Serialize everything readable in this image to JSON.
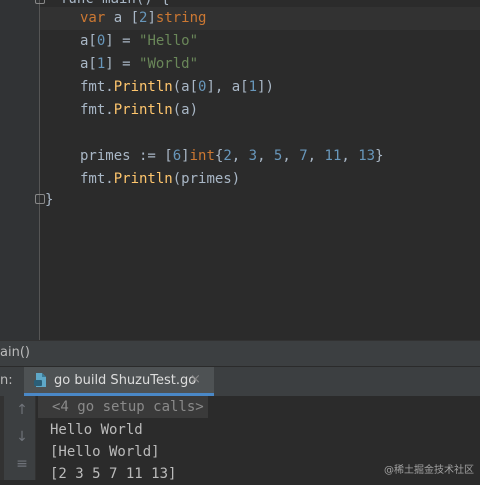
{
  "editor": {
    "top_clipped_text": "func main() {",
    "lines": [
      {
        "tokens": [
          {
            "t": "var",
            "c": "kw"
          },
          {
            "t": " a [",
            "c": ""
          },
          {
            "t": "2",
            "c": "num"
          },
          {
            "t": "]",
            "c": ""
          },
          {
            "t": "string",
            "c": "ty"
          }
        ]
      },
      {
        "tokens": [
          {
            "t": "a[",
            "c": ""
          },
          {
            "t": "0",
            "c": "num"
          },
          {
            "t": "] = ",
            "c": ""
          },
          {
            "t": "\"Hello\"",
            "c": "str"
          }
        ]
      },
      {
        "tokens": [
          {
            "t": "a[",
            "c": ""
          },
          {
            "t": "1",
            "c": "num"
          },
          {
            "t": "] = ",
            "c": ""
          },
          {
            "t": "\"World\"",
            "c": "str"
          }
        ]
      },
      {
        "tokens": [
          {
            "t": "fmt.",
            "c": ""
          },
          {
            "t": "Println",
            "c": "fn"
          },
          {
            "t": "(a[",
            "c": ""
          },
          {
            "t": "0",
            "c": "num"
          },
          {
            "t": "], a[",
            "c": ""
          },
          {
            "t": "1",
            "c": "num"
          },
          {
            "t": "])",
            "c": ""
          }
        ]
      },
      {
        "tokens": [
          {
            "t": "fmt.",
            "c": ""
          },
          {
            "t": "Println",
            "c": "fn"
          },
          {
            "t": "(a)",
            "c": ""
          }
        ]
      },
      {
        "tokens": []
      },
      {
        "tokens": [
          {
            "t": "primes := [",
            "c": ""
          },
          {
            "t": "6",
            "c": "num"
          },
          {
            "t": "]",
            "c": ""
          },
          {
            "t": "int",
            "c": "ty"
          },
          {
            "t": "{",
            "c": ""
          },
          {
            "t": "2",
            "c": "num"
          },
          {
            "t": ", ",
            "c": ""
          },
          {
            "t": "3",
            "c": "num"
          },
          {
            "t": ", ",
            "c": ""
          },
          {
            "t": "5",
            "c": "num"
          },
          {
            "t": ", ",
            "c": ""
          },
          {
            "t": "7",
            "c": "num"
          },
          {
            "t": ", ",
            "c": ""
          },
          {
            "t": "11",
            "c": "num"
          },
          {
            "t": ", ",
            "c": ""
          },
          {
            "t": "13",
            "c": "num"
          },
          {
            "t": "}",
            "c": ""
          }
        ]
      },
      {
        "tokens": [
          {
            "t": "fmt.",
            "c": ""
          },
          {
            "t": "Println",
            "c": "fn"
          },
          {
            "t": "(primes)",
            "c": ""
          }
        ]
      }
    ],
    "closing_brace": "}"
  },
  "breadcrumb": {
    "text": "ain()"
  },
  "run_panel": {
    "label": "n:",
    "tab_label": "go build ShuzuTest.go",
    "tab_close": "×"
  },
  "console": {
    "setup_line": "<4 go setup calls>",
    "setup_expand": "+",
    "output": [
      "Hello World",
      "[Hello World]",
      "[2 3 5 7 11 13]"
    ]
  },
  "toolbar_icons": [
    "arrow-up-icon",
    "arrow-down-icon",
    "soft-wrap-icon"
  ],
  "watermark": "@稀土掘金技术社区",
  "colors": {
    "keyword": "#cc7832",
    "number": "#6897bb",
    "string": "#6a8759",
    "function": "#ffc66d",
    "text": "#a9b7c6",
    "accent": "#4a88c7"
  }
}
